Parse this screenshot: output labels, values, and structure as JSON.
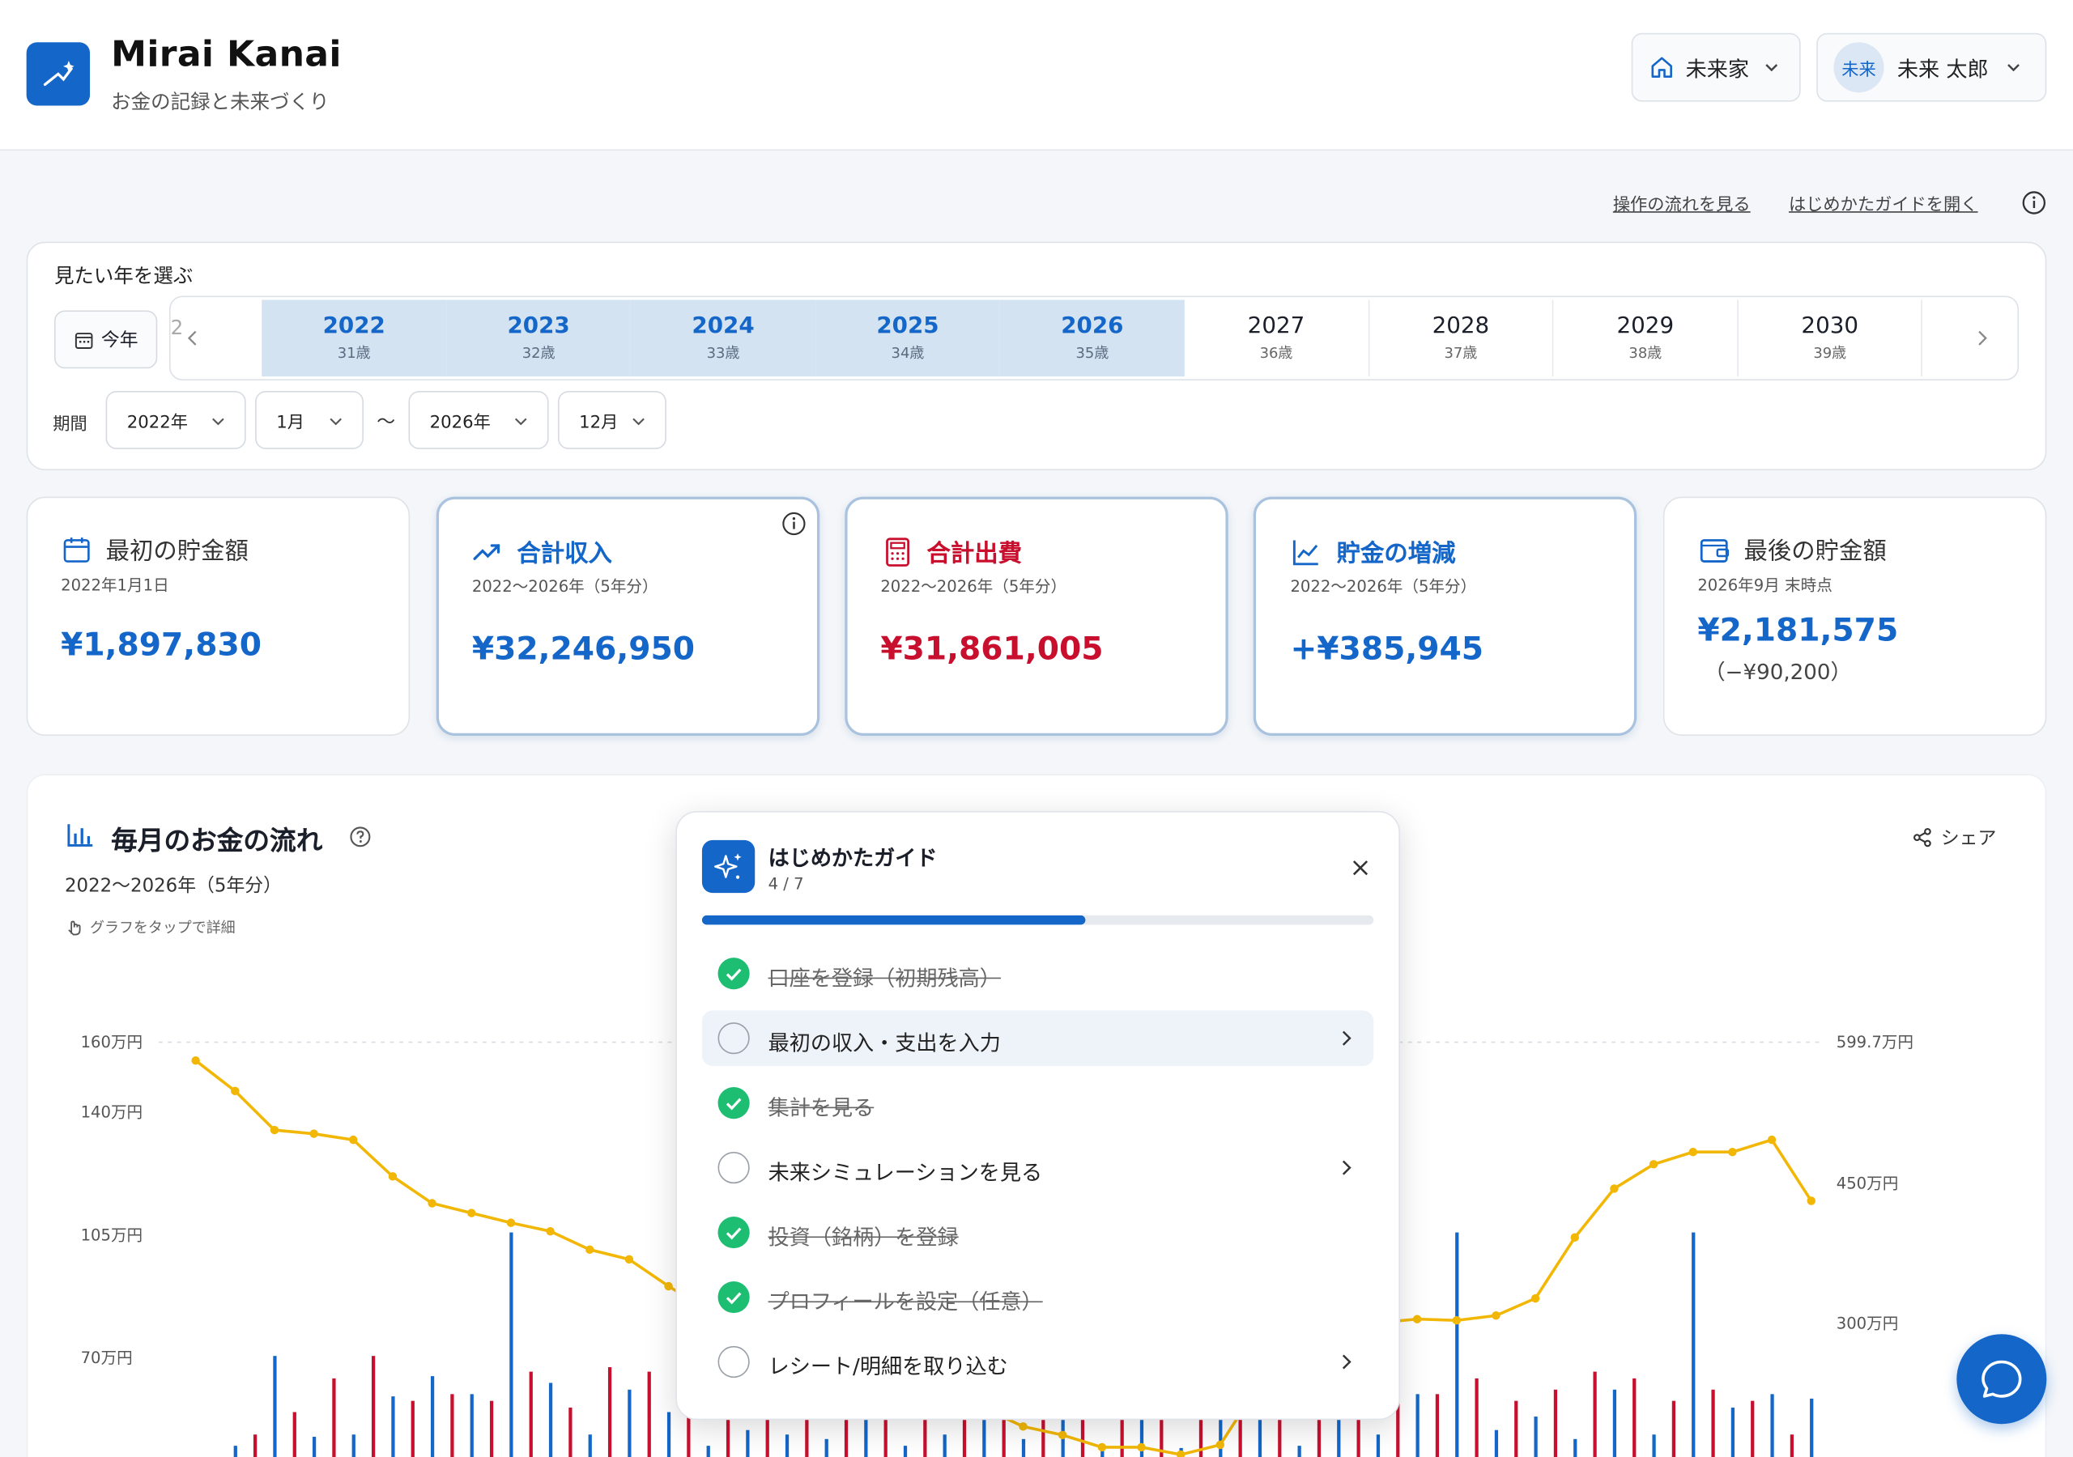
{
  "header": {
    "app_name": "Mirai Kanai",
    "tagline": "お金の記録と未来づくり",
    "household_label": "未来家",
    "avatar_text": "未来",
    "user_name": "未来 太郎"
  },
  "top_links": {
    "flow_link": "操作の流れを見る",
    "guide_link": "はじめかたガイドを開く"
  },
  "year_picker": {
    "title": "見たい年を選ぶ",
    "today_label": "今年",
    "years": [
      {
        "year": "2022",
        "age": "31歳",
        "selected": true
      },
      {
        "year": "2023",
        "age": "32歳",
        "selected": true
      },
      {
        "year": "2024",
        "age": "33歳",
        "selected": true
      },
      {
        "year": "2025",
        "age": "34歳",
        "selected": true
      },
      {
        "year": "2026",
        "age": "35歳",
        "selected": true
      },
      {
        "year": "2027",
        "age": "36歳",
        "selected": false
      },
      {
        "year": "2028",
        "age": "37歳",
        "selected": false
      },
      {
        "year": "2029",
        "age": "38歳",
        "selected": false
      },
      {
        "year": "2030",
        "age": "39歳",
        "selected": false
      }
    ],
    "period_label": "期間",
    "from_year": "2022年",
    "from_month": "1月",
    "tilde": "〜",
    "to_year": "2026年",
    "to_month": "12月"
  },
  "summary_cards": [
    {
      "title": "最初の貯金額",
      "sub": "2022年1月1日",
      "value": "¥1,897,830",
      "color": "#1466c8"
    },
    {
      "title": "合計収入",
      "sub": "2022〜2026年（5年分）",
      "value": "¥32,246,950",
      "color": "#1466c8"
    },
    {
      "title": "合計出費",
      "sub": "2022〜2026年（5年分）",
      "value": "¥31,861,005",
      "color": "#c8102e"
    },
    {
      "title": "貯金の増減",
      "sub": "2022〜2026年（5年分）",
      "value": "+¥385,945",
      "color": "#1466c8"
    },
    {
      "title": "最後の貯金額",
      "sub": "2026年9月 末時点",
      "value": "¥2,181,575",
      "note": "（−¥90,200）",
      "color": "#1466c8"
    }
  ],
  "chart_section": {
    "title": "毎月のお金の流れ",
    "subtitle": "2022〜2026年（5年分）",
    "hint": "グラフをタップで詳細",
    "share_label": "シェア"
  },
  "chart_data": {
    "type": "bar",
    "left_axis_ticks": [
      "160万円",
      "140万円",
      "105万円",
      "70万円"
    ],
    "right_axis_ticks": [
      "599.7万円",
      "450万円",
      "300万円"
    ],
    "series": [
      {
        "values": [
          0,
          5,
          45,
          9,
          10,
          27,
          36,
          28,
          100,
          33,
          10,
          30,
          20,
          5,
          12,
          10,
          8,
          20,
          5,
          10,
          22,
          8,
          30,
          5,
          22,
          4,
          30,
          18,
          5,
          24,
          10,
          28,
          100,
          12,
          18,
          8,
          30,
          10,
          100,
          22,
          28,
          26
        ],
        "color": "#1466c8"
      },
      {
        "values": [
          0,
          10,
          20,
          35,
          45,
          25,
          28,
          25,
          38,
          22,
          40,
          38,
          22,
          95,
          35,
          20,
          40,
          35,
          40,
          38,
          30,
          40,
          38,
          35,
          40,
          22,
          35,
          28,
          35,
          30,
          40,
          28,
          35,
          25,
          30,
          38,
          35,
          25,
          30,
          25,
          10,
          0
        ],
        "color": "#c8102e"
      },
      {
        "values": [
          585,
          560,
          528,
          525,
          520,
          490,
          468,
          460,
          452,
          445,
          430,
          422,
          400,
          380,
          372,
          372,
          348,
          336,
          336,
          320,
          300,
          285,
          278,
          268,
          268,
          262,
          270,
          320,
          350,
          360,
          370,
          373,
          372,
          376,
          390,
          440,
          480,
          500,
          510,
          510,
          520,
          470
        ],
        "color": "#f2b705"
      }
    ]
  },
  "guide": {
    "title": "はじめかたガイド",
    "progress_text": "4 / 7",
    "progress": 0.57,
    "items": [
      {
        "label": "口座を登録（初期残高）",
        "done": true
      },
      {
        "label": "最初の収入・支出を入力",
        "done": false
      },
      {
        "label": "集計を見る",
        "done": true
      },
      {
        "label": "未来シミュレーションを見る",
        "done": false
      },
      {
        "label": "投資（銘柄）を登録",
        "done": true
      },
      {
        "label": "プロフィールを設定（任意）",
        "done": true
      },
      {
        "label": "レシート/明細を取り込む",
        "done": false
      }
    ]
  }
}
